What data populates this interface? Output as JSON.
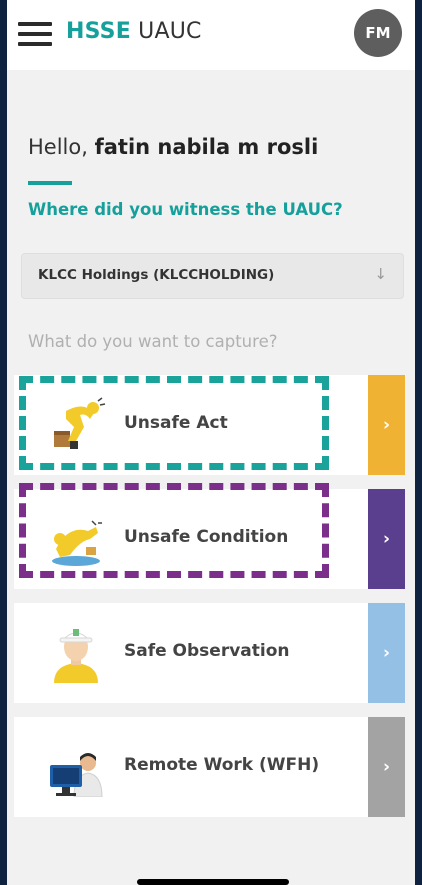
{
  "header": {
    "brand_bold": "HSSE",
    "brand_rest": " UAUC",
    "avatar_initials": "FM"
  },
  "greeting": {
    "prefix": "Hello, ",
    "name": "fatin nabila m rosli"
  },
  "location": {
    "question": "Where did you witness the UAUC?",
    "selected": "KLCC Holdings (KLCCHOLDING)",
    "arrow": "↓"
  },
  "capture": {
    "prompt": "What do you want to capture?",
    "options": [
      {
        "label": "Unsafe Act",
        "chevron": "›",
        "color": "#f0b232"
      },
      {
        "label": "Unsafe Condition",
        "chevron": "›",
        "color": "#5b3f8f"
      },
      {
        "label": "Safe Observation",
        "chevron": "›",
        "color": "#94c0e6"
      },
      {
        "label": "Remote Work (WFH)",
        "chevron": "›",
        "color": "#a3a3a3"
      }
    ]
  },
  "colors": {
    "teal": "#16a09c",
    "highlight_teal": "#1aa39b",
    "highlight_purple": "#7b2f8a"
  }
}
